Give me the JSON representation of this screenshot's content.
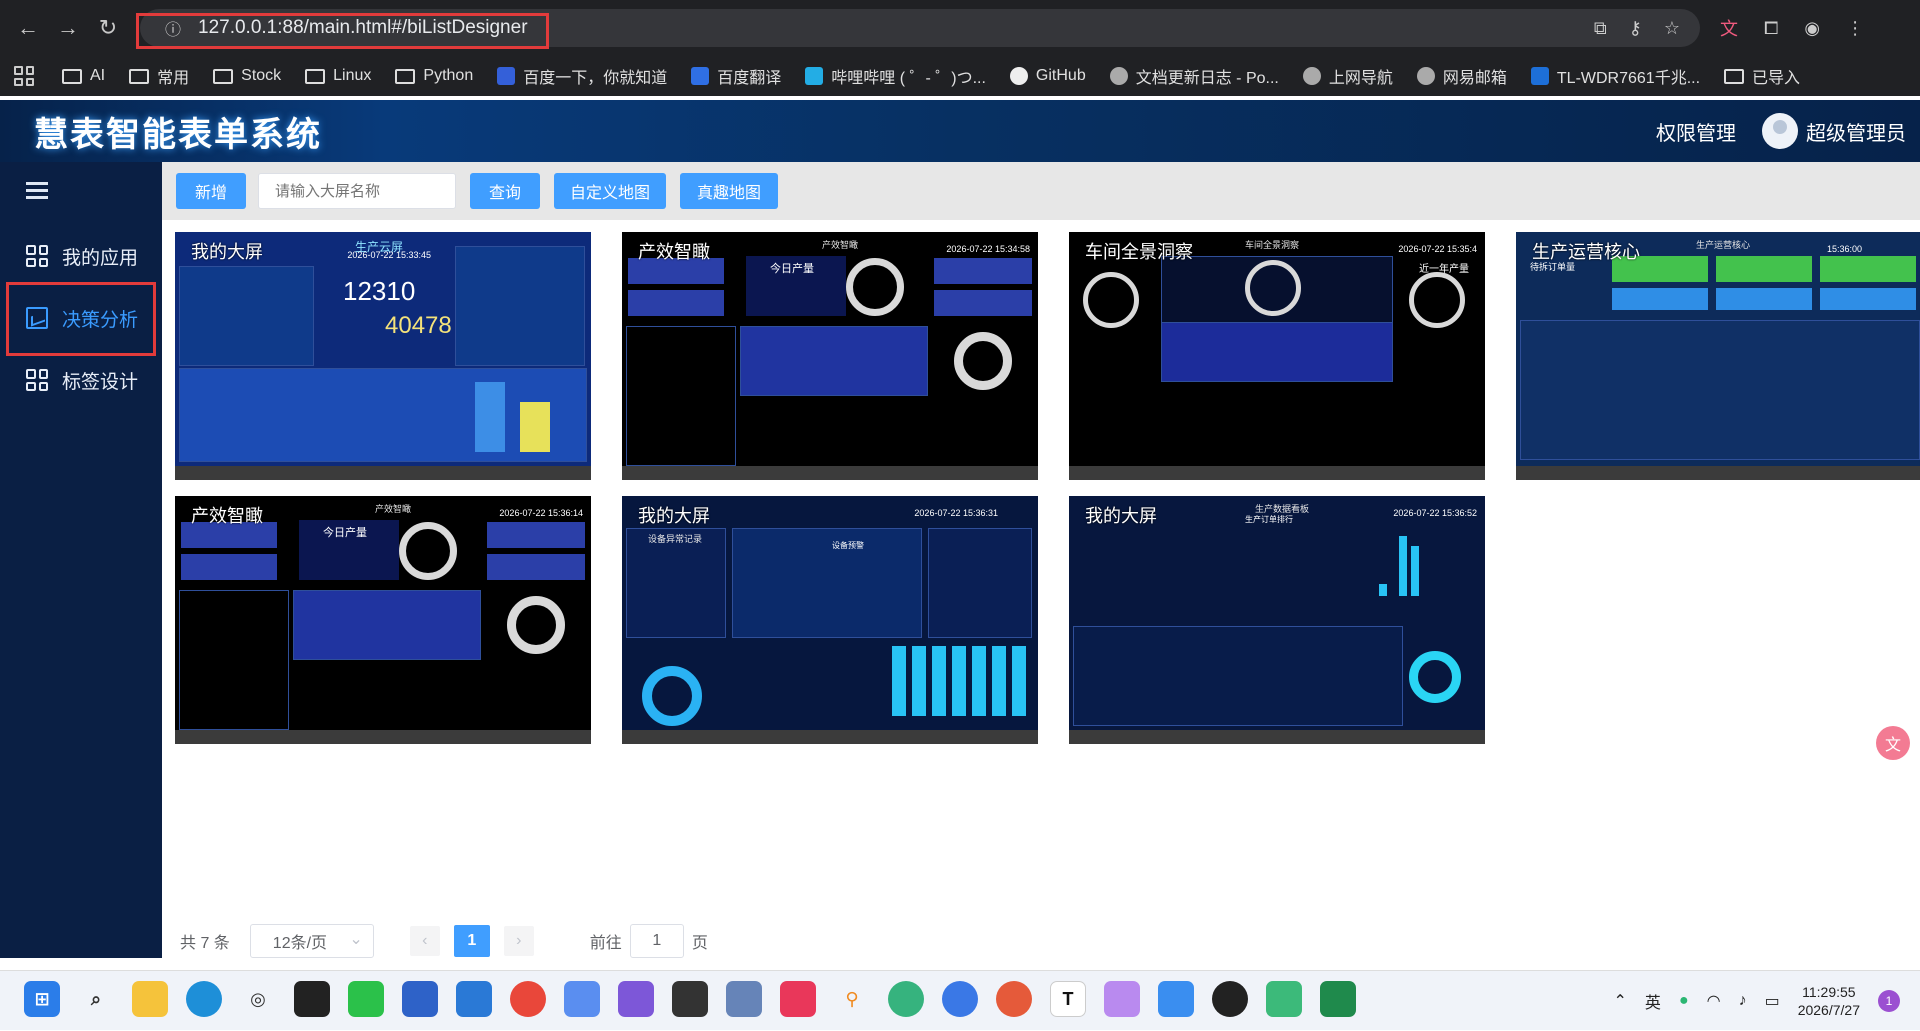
{
  "browser": {
    "url": "127.0.0.1:88/main.html#/biListDesigner",
    "bookmarks": [
      "AI",
      "常用",
      "Stock",
      "Linux",
      "Python",
      "百度一下，你就知道",
      "百度翻译",
      "哔哩哔哩 ( ゜- ゜)つ...",
      "GitHub",
      "文档更新日志 - Po...",
      "上网导航",
      "网易邮箱",
      "TL-WDR7661千兆...",
      "已导入"
    ]
  },
  "header": {
    "title": "慧表智能表单系统",
    "perm_label": "权限管理",
    "user_name": "超级管理员"
  },
  "sidebar": {
    "items": [
      {
        "label": "我的应用",
        "icon": "grid-icon"
      },
      {
        "label": "决策分析",
        "icon": "chart-icon",
        "active": true
      },
      {
        "label": "标签设计",
        "icon": "grid-icon"
      }
    ]
  },
  "toolbar": {
    "add_label": "新增",
    "search_placeholder": "请输入大屏名称",
    "query_label": "查询",
    "custom_map_label": "自定义地图",
    "real_map_label": "真趣地图"
  },
  "cards": [
    {
      "name": "我的大屏",
      "sub": "生产云屏",
      "date": "2026-07-22 15:33:45",
      "big1": "12310",
      "big2": "40478"
    },
    {
      "name": "产效智瞰",
      "sub": "产效智瞰",
      "date": "2026-07-22 15:34:58",
      "label1": "今日产量"
    },
    {
      "name": "车间全景洞察",
      "sub": "车间全景洞察",
      "date": "2026-07-22 15:35:4",
      "label1": "近一年产量"
    },
    {
      "name": "生产运营核心",
      "sub": "生产运营核心",
      "date": "15:36:00",
      "label1": "待拆订单量"
    },
    {
      "name": "产效智瞰",
      "sub": "产效智瞰",
      "date": "2026-07-22 15:36:14",
      "label1": "今日产量"
    },
    {
      "name": "我的大屏",
      "sub": "设备异常记录",
      "date": "2026-07-22 15:36:31",
      "label1": "设备预警"
    },
    {
      "name": "我的大屏",
      "sub": "生产数据看板",
      "date": "2026-07-22 15:36:52",
      "label1": "生产订单排行"
    }
  ],
  "pagination": {
    "total": "共 7 条",
    "page_size": "12条/页",
    "current_page": "1",
    "goto_prefix": "前往",
    "goto_value": "1",
    "goto_suffix": "页"
  },
  "taskbar": {
    "ime": "英",
    "time": "11:29:55",
    "date": "2026/7/27",
    "notifications": "1"
  },
  "colors": {
    "primary": "#409eff",
    "sidebar_bg": "#0a1f44",
    "highlight_border": "#e23b3b"
  }
}
